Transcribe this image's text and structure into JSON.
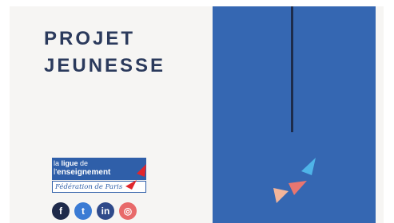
{
  "document": {
    "title_line1": "PROJET",
    "title_line2": "JEUNESSE"
  },
  "logo": {
    "line1_prefix": "la ",
    "line1_bold": "ligue",
    "line1_suffix": " de",
    "line2_prefix": "l'",
    "line2_bold": "enseignement",
    "subtitle": "Fédération de Paris"
  },
  "social": [
    {
      "name": "facebook",
      "glyph": "f"
    },
    {
      "name": "twitter",
      "glyph": "t"
    },
    {
      "name": "linkedin",
      "glyph": "in"
    },
    {
      "name": "instagram",
      "glyph": "◎"
    }
  ],
  "colors": {
    "title": "#2b3a5c",
    "paper": "#f6f5f3",
    "panel_blue": "#3567b2",
    "arrow_cyan": "#4fb4e8",
    "arrow_coral": "#e87670",
    "arrow_peach": "#f3b59a",
    "flag_red": "#e1262c"
  }
}
